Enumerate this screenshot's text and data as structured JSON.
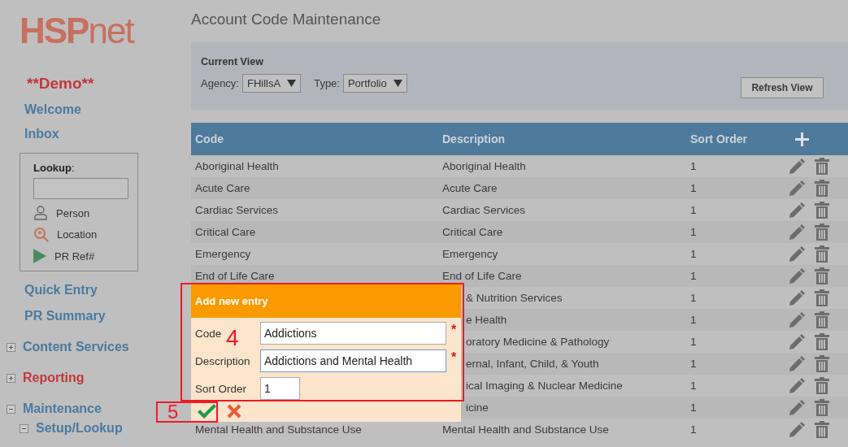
{
  "logo": "**HSP**net",
  "environment": "**Demo**",
  "sidebar": {
    "links": [
      "Welcome",
      "Inbox"
    ],
    "lookup": {
      "label": "**Lookup**:",
      "options": [
        {
          "kind": "person",
          "label": "Person"
        },
        {
          "kind": "location",
          "label": "Location"
        },
        {
          "kind": "play",
          "label": "PR Ref#"
        }
      ]
    },
    "links_2": [
      "Quick Entry",
      "PR Summary"
    ],
    "nav": [
      {
        "label": "Content Services",
        "expanded": false,
        "highlighted": false
      },
      {
        "label": "Reporting",
        "expanded": false,
        "highlighted": true
      },
      {
        "label": "Maintenance",
        "expanded": true,
        "highlighted": false,
        "children": [
          {
            "label": "Setup/Lookup",
            "expanded": true,
            "highlighted": false
          }
        ]
      }
    ]
  },
  "page_title": "Account Code Maintenance",
  "current_view": {
    "title": "Current View",
    "filters": [
      {
        "label": "Agency:",
        "value": "FHillsA"
      },
      {
        "label": "Type:",
        "value": "Portfolio"
      }
    ],
    "refresh_button": "Refresh View"
  },
  "table": {
    "columns": [
      "Code",
      "Description",
      "Sort Order"
    ],
    "rows": [
      {
        "code": "Aboriginal Health",
        "description": "Aboriginal Health",
        "sort_order": "1"
      },
      {
        "code": "Acute Care",
        "description": "Acute Care",
        "sort_order": "1"
      },
      {
        "code": "Cardiac Services",
        "description": "Cardiac Services",
        "sort_order": "1"
      },
      {
        "code": "Critical Care",
        "description": "Critical Care",
        "sort_order": "1"
      },
      {
        "code": "Emergency",
        "description": "Emergency",
        "sort_order": "1"
      },
      {
        "code": "End of Life Care",
        "description": "End of Life Care",
        "sort_order": "1"
      },
      {
        "description": "& Nutrition Services",
        "sort_order": "1"
      },
      {
        "description": "e Health",
        "sort_order": "1"
      },
      {
        "description": "oratory Medicine & Pathology",
        "sort_order": "1"
      },
      {
        "description": "ernal, Infant, Child, & Youth",
        "sort_order": "1"
      },
      {
        "description": "ical Imaging & Nuclear Medicine",
        "sort_order": "1"
      },
      {
        "description": "icine",
        "sort_order": "1"
      },
      {
        "code": "Mental Health and Substance Use",
        "description": "Mental Health and Substance Use",
        "sort_order": "1"
      }
    ]
  },
  "dialog": {
    "title": "Add new entry",
    "fields": [
      {
        "label": "Code",
        "value": "Addictions",
        "required": true,
        "focused": false,
        "kind": "wide"
      },
      {
        "label": "Description",
        "value": "Addictions and Mental Health",
        "required": true,
        "focused": true,
        "kind": "wide"
      },
      {
        "label": "Sort Order",
        "value": "1",
        "required": false,
        "focused": false,
        "kind": "narrow"
      }
    ],
    "required_mark": "*"
  },
  "annotations": [
    {
      "label": "4",
      "kind": "form"
    },
    {
      "label": "5",
      "kind": "save"
    }
  ]
}
